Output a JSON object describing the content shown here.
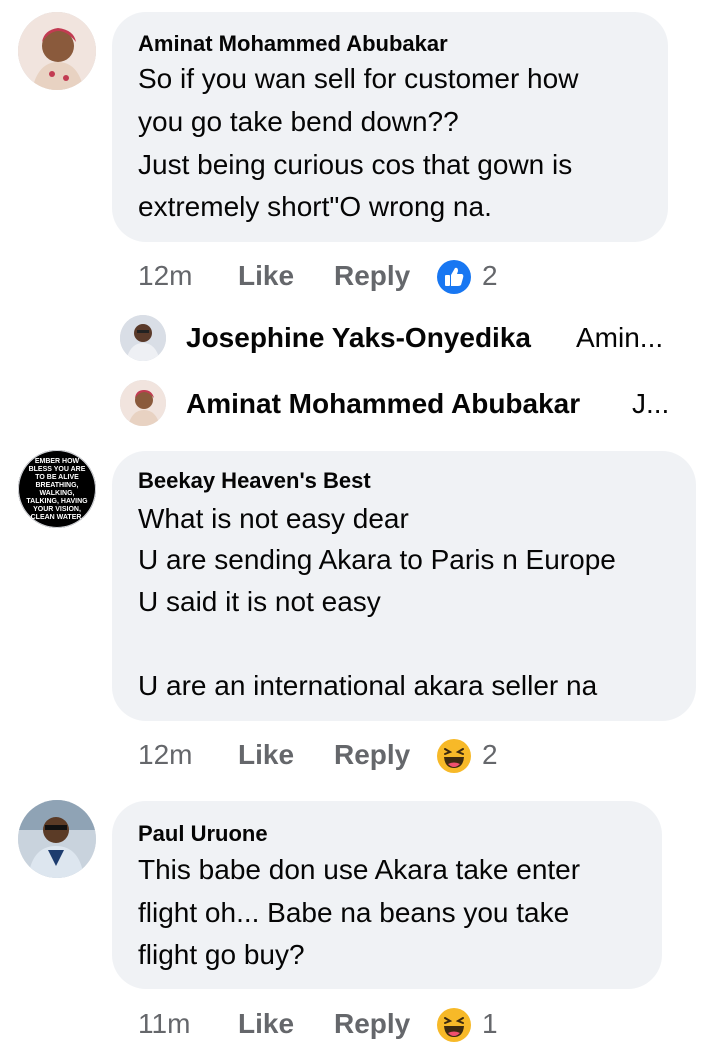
{
  "comments": [
    {
      "author": "Aminat Mohammed Abubakar",
      "lines": [
        "So if you wan sell for customer how",
        "you go take bend down??",
        "Just being curious cos that gown is",
        "extremely short\"O wrong na."
      ],
      "time": "12m",
      "like_label": "Like",
      "reply_label": "Reply",
      "reaction": "like-icon",
      "reaction_count": "2",
      "replies": [
        {
          "author": "Josephine Yaks-Onyedika",
          "preview": "Amin..."
        },
        {
          "author": "Aminat Mohammed Abubakar",
          "preview": "J..."
        }
      ]
    },
    {
      "author": "Beekay Heaven's Best",
      "avatar_text": "EMBER HOW BLESS YOU ARE TO BE ALIVE BREATHING, WALKING, TALKING, HAVING YOUR VISION, CLEAN WATER, FOOD TO EAT, BEING ABLE TO SLEEP AND MAKE U U ARE BLESSE",
      "lines": [
        "What is not easy dear",
        "U are sending Akara to Paris n Europe",
        "U said it is not easy",
        "",
        "U are an international akara seller na"
      ],
      "time": "12m",
      "like_label": "Like",
      "reply_label": "Reply",
      "reaction": "haha-icon",
      "reaction_count": "2"
    },
    {
      "author": "Paul Uruone",
      "lines": [
        "This babe don use Akara take enter",
        "flight oh... Babe na beans you take",
        "flight go buy?"
      ],
      "time": "11m",
      "like_label": "Like",
      "reply_label": "Reply",
      "reaction": "haha-icon",
      "reaction_count": "1"
    }
  ],
  "colors": {
    "bubble": "#f0f2f5",
    "meta_text": "#65676b",
    "like_blue": "#1877f2",
    "haha_yellow": "#f7b928"
  }
}
